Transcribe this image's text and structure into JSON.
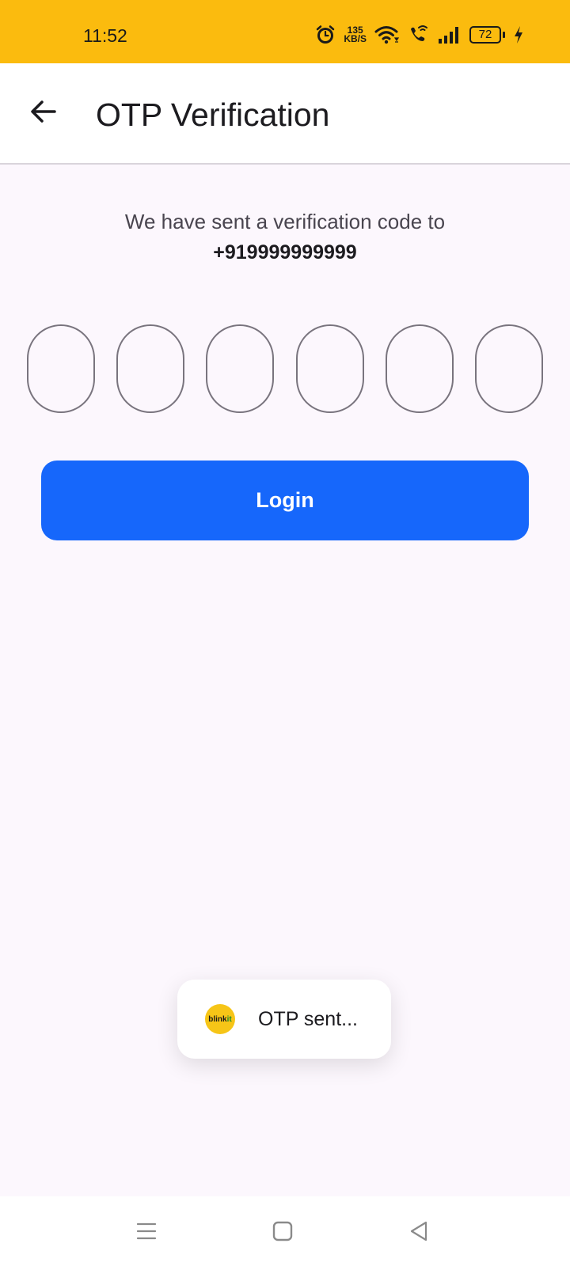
{
  "status_bar": {
    "time": "11:52",
    "net_speed_value": "135",
    "net_speed_unit": "KB/S",
    "battery_level": "72",
    "background_color": "#fbbb0e",
    "icons": [
      "alarm-icon",
      "wifi-icon",
      "wifi-calling-icon",
      "signal-icon",
      "battery-icon",
      "charging-icon"
    ]
  },
  "app_bar": {
    "title": "OTP Verification",
    "back_icon": "arrow-left-icon"
  },
  "verification": {
    "message": "We have sent a verification code to",
    "phone_number": "+919999999999",
    "otp_digits": [
      "",
      "",
      "",
      "",
      "",
      ""
    ]
  },
  "login_button": {
    "label": "Login",
    "color": "#1667fb"
  },
  "toast": {
    "logo_text_main": "blink",
    "logo_text_accent": "it",
    "message": "OTP sent..."
  },
  "nav_bar": {
    "buttons": [
      "recents-icon",
      "home-icon",
      "back-icon"
    ]
  }
}
